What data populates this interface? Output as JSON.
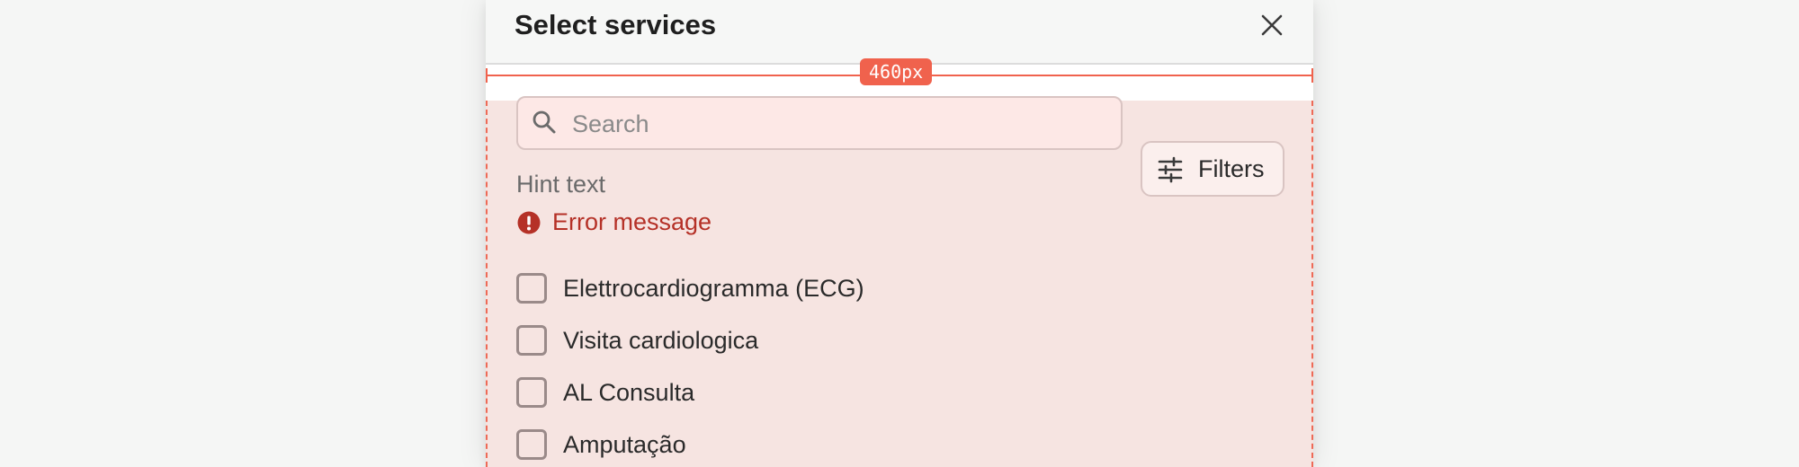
{
  "dialog": {
    "title": "Select services"
  },
  "measurement": {
    "label": "460px"
  },
  "search": {
    "placeholder": "Search",
    "value": ""
  },
  "filters": {
    "label": "Filters"
  },
  "hint": "Hint text",
  "error": "Error message",
  "services": [
    {
      "label": "Elettrocardiogramma (ECG)",
      "checked": false
    },
    {
      "label": "Visita cardiologica",
      "checked": false
    },
    {
      "label": "AL Consulta",
      "checked": false
    },
    {
      "label": "Amputação",
      "checked": false
    }
  ],
  "colors": {
    "accent": "#f0624d",
    "error": "#b53127",
    "content_background": "#f6e4e1"
  },
  "icons": {
    "close": "close-icon",
    "search": "search-icon",
    "filters": "sliders-icon",
    "error": "error-circle-icon"
  }
}
